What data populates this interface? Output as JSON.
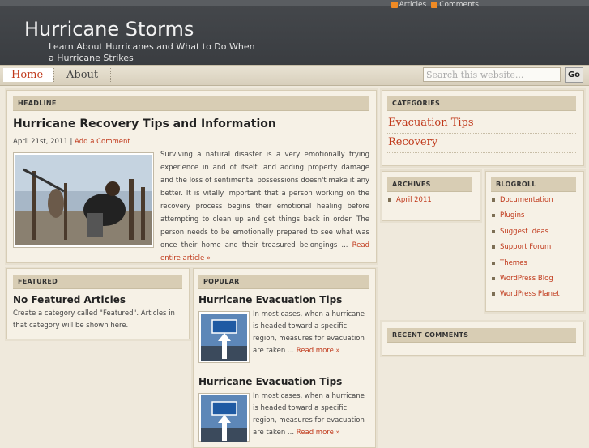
{
  "header": {
    "title": "Hurricane Storms",
    "description": "Learn About Hurricanes and What to Do When a Hurricane Strikes",
    "feeds": {
      "articles": "Articles",
      "comments": "Comments"
    }
  },
  "nav": {
    "home": "Home",
    "about": "About"
  },
  "search": {
    "placeholder": "Search this website...",
    "button": "Go"
  },
  "headline": {
    "section": "HEADLINE",
    "title": "Hurricane Recovery Tips and Information",
    "date": "April 21st, 2011",
    "comment_sep": "|",
    "comment_link": "Add a Comment",
    "excerpt": "Surviving a natural disaster is a very emotionally trying experience in and of itself, and adding property damage and the loss of sentimental possessions doesn't make it any better. It is vitally important that a person working on the recovery process begins their emotional healing before attempting to clean up and get things back in order. The person needs to be emotionally prepared to see what was once their home and their treasured belongings ...",
    "read_more": "Read entire article »"
  },
  "featured": {
    "section": "FEATURED",
    "title": "No Featured Articles",
    "text": "Create a category called \"Featured\". Articles in that category will be shown here."
  },
  "popular": {
    "section": "POPULAR",
    "items": [
      {
        "title": "Hurricane Evacuation Tips",
        "text": "In most cases, when a hurricane is headed toward a specific region, measures for evacuation are taken ...",
        "more": "Read more »"
      },
      {
        "title": "Hurricane Evacuation Tips",
        "text": "In most cases, when a hurricane is headed toward a specific region, measures for evacuation are taken ...",
        "more": "Read more »"
      }
    ]
  },
  "categories": {
    "section": "CATEGORIES",
    "items": [
      "Evacuation Tips",
      "Recovery"
    ]
  },
  "archives": {
    "section": "ARCHIVES",
    "items": [
      "April 2011"
    ]
  },
  "blogroll": {
    "section": "BLOGROLL",
    "items": [
      "Documentation",
      "Plugins",
      "Suggest Ideas",
      "Support Forum",
      "Themes",
      "WordPress Blog",
      "WordPress Planet"
    ]
  },
  "recent_comments": {
    "section": "RECENT COMMENTS"
  },
  "colors": {
    "accent": "#c0391b",
    "header_bg": "#3f4246",
    "panel_bg": "#f6f1e6",
    "panel_head": "#d8cdb4"
  }
}
